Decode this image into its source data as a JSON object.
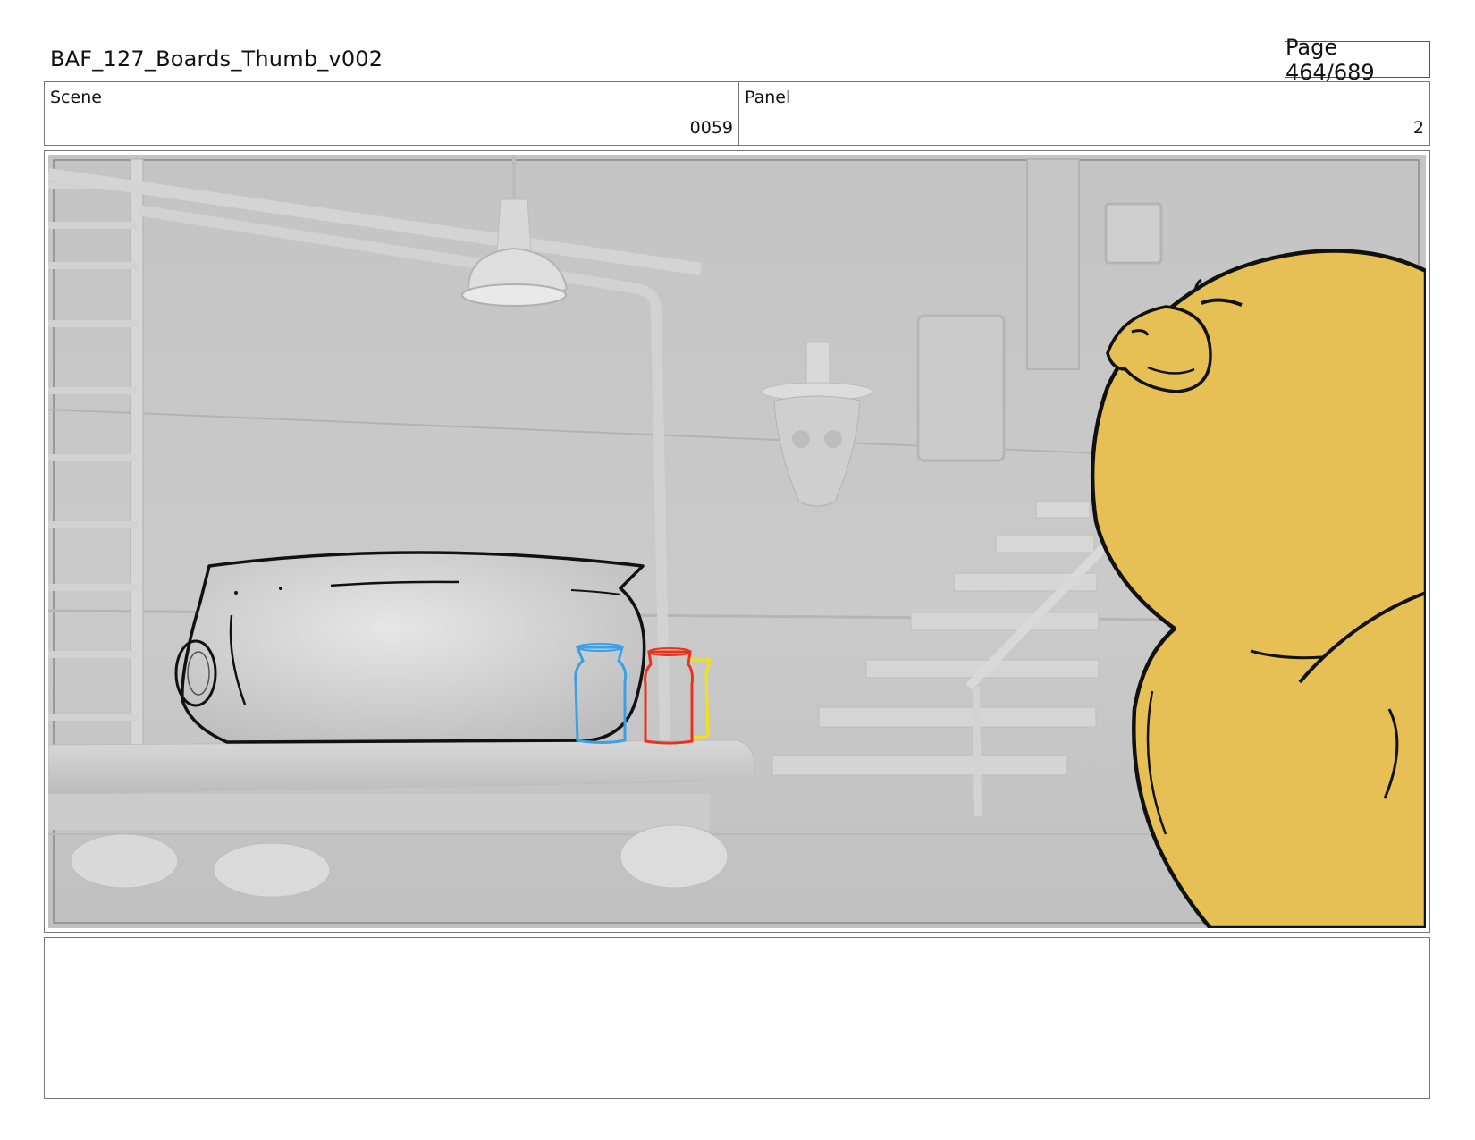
{
  "header": {
    "title": "BAF_127_Boards_Thumb_v002",
    "page": "Page 464/689"
  },
  "scene": {
    "label": "Scene",
    "value": "0059"
  },
  "panel": {
    "label": "Panel",
    "value": "2"
  },
  "notes": {
    "text": ""
  },
  "colors": {
    "character_fill": "#E6BF55",
    "jar_blue": "#3AA0E8",
    "jar_red": "#E8341E",
    "jar_yellow": "#F2E214",
    "set_gray": "#C8C8C8"
  }
}
